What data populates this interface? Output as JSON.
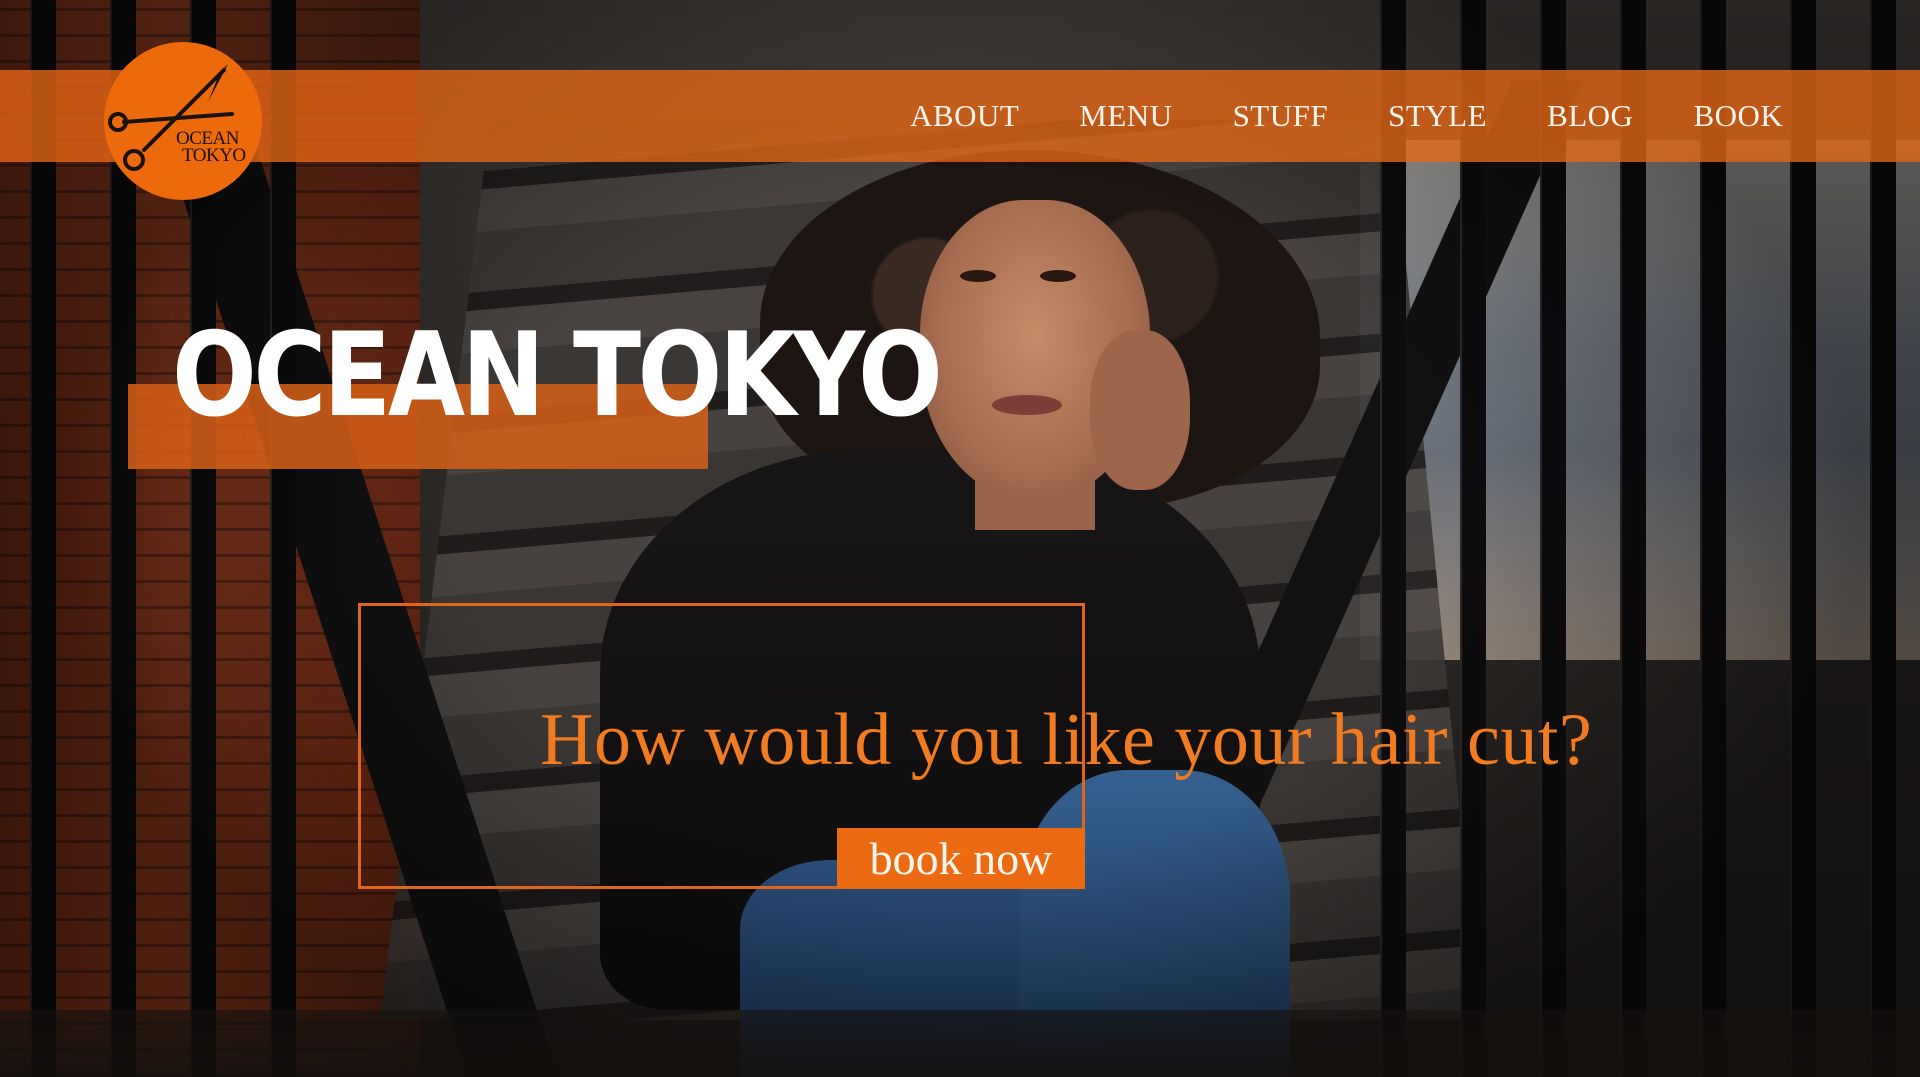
{
  "brand": {
    "logo_line1": "OCEAN",
    "logo_line2": "TOKYO",
    "accent_color": "#ec6a12"
  },
  "nav": {
    "items": [
      {
        "label": "ABOUT"
      },
      {
        "label": "MENU"
      },
      {
        "label": "STUFF"
      },
      {
        "label": "STYLE"
      },
      {
        "label": "BLOG"
      },
      {
        "label": "BOOK"
      }
    ]
  },
  "hero": {
    "title": "OCEAN TOKYO",
    "question": "How would you like your hair cut?",
    "cta_label": "book now"
  },
  "icons": {
    "logo_icon": "scissors-icon"
  }
}
